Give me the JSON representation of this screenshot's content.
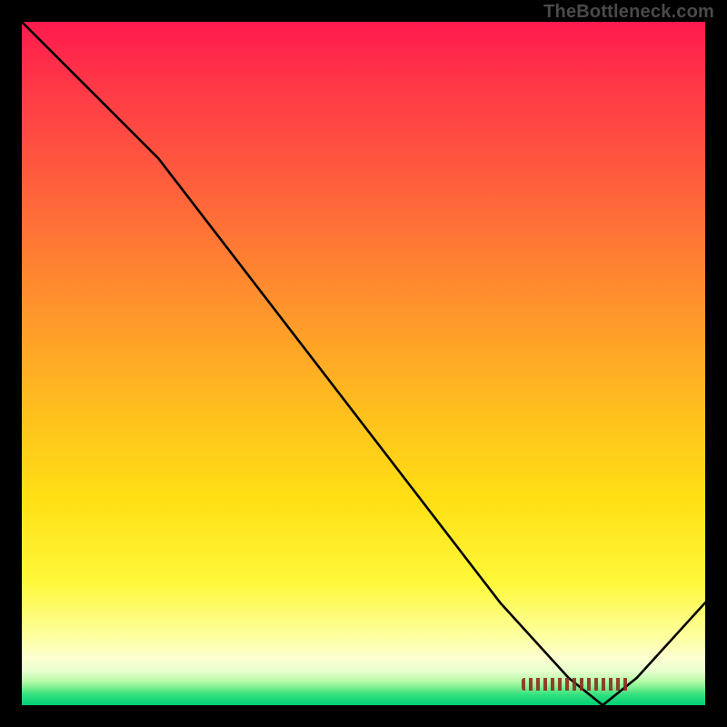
{
  "watermark": "TheBottleneck.com",
  "chart_data": {
    "type": "line",
    "title": "",
    "xlabel": "",
    "ylabel": "",
    "xlim": [
      0,
      100
    ],
    "ylim": [
      0,
      100
    ],
    "grid": false,
    "series": [
      {
        "name": "curve",
        "x": [
          0,
          8,
          20,
          30,
          40,
          50,
          60,
          70,
          80,
          85,
          90,
          100
        ],
        "values": [
          100,
          92,
          80,
          67,
          54,
          41,
          28,
          15,
          4,
          0,
          4,
          15
        ]
      }
    ],
    "background_gradient": {
      "stops": [
        {
          "pos": 0.0,
          "color": "#ff1a4f"
        },
        {
          "pos": 0.22,
          "color": "#ff5a3e"
        },
        {
          "pos": 0.46,
          "color": "#ffa028"
        },
        {
          "pos": 0.7,
          "color": "#ffe014"
        },
        {
          "pos": 0.9,
          "color": "#fdffa0"
        },
        {
          "pos": 0.97,
          "color": "#76ef8e"
        },
        {
          "pos": 1.0,
          "color": "#00d075"
        }
      ]
    },
    "annotations": [
      {
        "name": "baseline-marker",
        "approx_x_range": [
          73,
          89
        ],
        "approx_y": 1
      }
    ]
  }
}
